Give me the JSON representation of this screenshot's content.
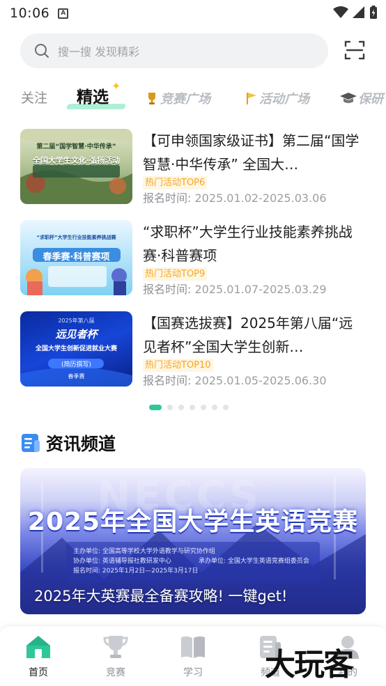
{
  "status_bar": {
    "time": "10:06",
    "app_icon_letter": "A"
  },
  "search": {
    "placeholder": "搜一搜 发现精彩"
  },
  "tabs": {
    "follow": "关注",
    "featured": "精选",
    "contest_square": "竞赛广场",
    "activity_square": "活动广场",
    "grad": "保研"
  },
  "activities": [
    {
      "title": "【可申领国家级证书】第二届“国学智慧·中华传承” 全国大…",
      "tag": "热门活动TOP6",
      "time_label": "报名时间:",
      "time_range": "2025.01.02-2025.03.06",
      "thumb_top": "第二届“国学智慧·中华传承”",
      "thumb_main": "全国大学生文化·弘扬活动"
    },
    {
      "title": "“求职杯”大学生行业技能素养挑战赛·科普赛项",
      "tag": "热门活动TOP9",
      "time_label": "报名时间:",
      "time_range": "2025.01.07-2025.03.29",
      "thumb_top": "“求职杯”大学生行业技能素养挑战赛",
      "thumb_main": "春季赛·科普赛项"
    },
    {
      "title": "【国赛选拔赛】2025年第八届“远见者杯”全国大学生创新…",
      "tag": "热门活动TOP10",
      "time_label": "报名时间:",
      "time_range": "2025.01.05-2025.06.30",
      "thumb_top": "2025年第八届",
      "thumb_brand": "远见者杯",
      "thumb_main": "全国大学生创新促进就业大赛",
      "thumb_sub": "(简历撰写)",
      "thumb_season": "春季赛"
    }
  ],
  "pager": {
    "count": 7,
    "active_index": 0
  },
  "news": {
    "section_title": "资讯频道",
    "banner_headline": "2025年全国大学生英语竞赛",
    "banner_watermark": "NECCS",
    "banner_lines": [
      "主办单位: 全国高等学校大学外语教学与研究协作组",
      "协办单位: 英语辅导报社教研发中心",
      "承办单位: 全国大学生英语竞赛组委员会",
      "报名时间: 2025年1月2日—2025年3月17日"
    ],
    "banner_caption": "2025年大英赛最全备赛攻略! 一键get!"
  },
  "bottom_nav": [
    {
      "label": "首页",
      "icon": "home-icon",
      "active": true
    },
    {
      "label": "竞赛",
      "icon": "trophy-icon",
      "active": false
    },
    {
      "label": "学习",
      "icon": "book-icon",
      "active": false
    },
    {
      "label": "频道",
      "icon": "channel-icon",
      "active": false
    },
    {
      "label": "我的",
      "icon": "user-icon",
      "active": false
    }
  ],
  "watermark": "大玩客",
  "colors": {
    "accent": "#2ec79a",
    "tag_text": "#f5a623",
    "tag_bg": "#fff6e3",
    "news_icon": "#3a8df0"
  }
}
